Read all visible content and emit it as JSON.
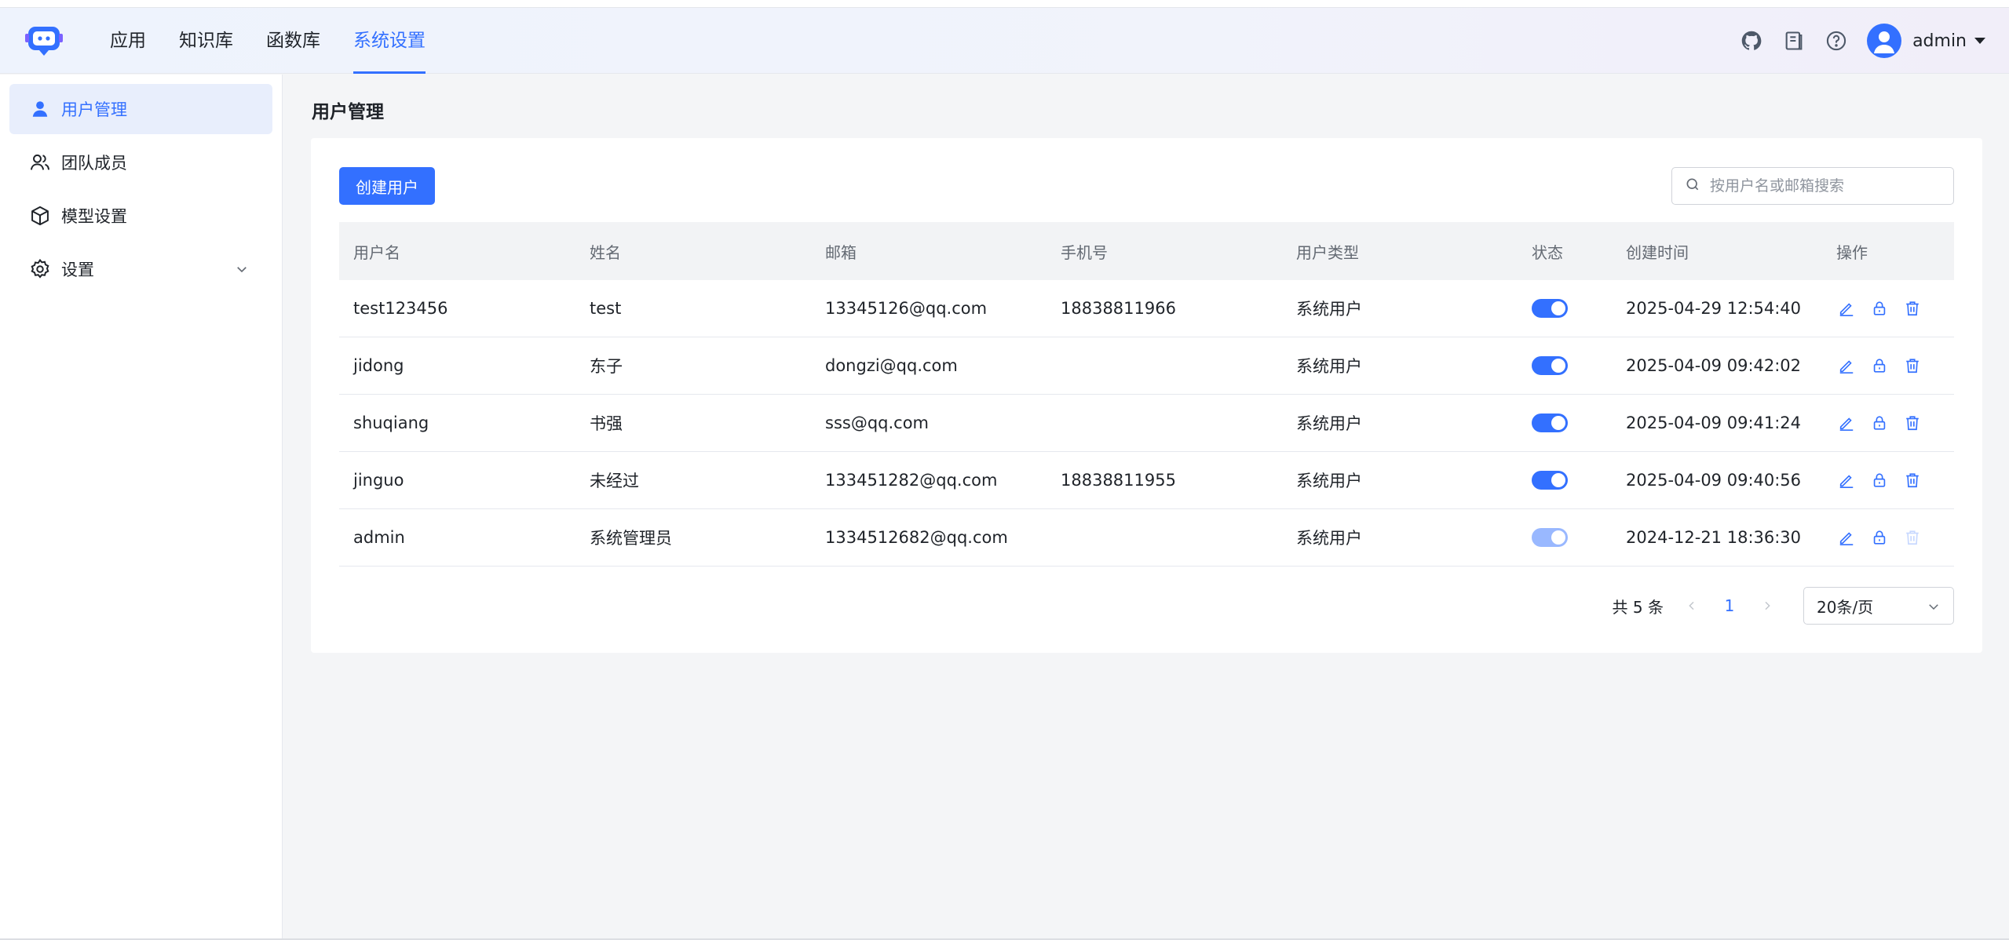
{
  "header": {
    "nav": [
      {
        "label": "应用",
        "active": false
      },
      {
        "label": "知识库",
        "active": false
      },
      {
        "label": "函数库",
        "active": false
      },
      {
        "label": "系统设置",
        "active": true
      }
    ],
    "icons": [
      "github-icon",
      "document-icon",
      "help-icon"
    ],
    "user": {
      "name": "admin"
    }
  },
  "sidebar": {
    "items": [
      {
        "label": "用户管理",
        "icon": "user-icon",
        "active": true
      },
      {
        "label": "团队成员",
        "icon": "team-icon",
        "active": false
      },
      {
        "label": "模型设置",
        "icon": "cube-icon",
        "active": false
      },
      {
        "label": "设置",
        "icon": "gear-icon",
        "active": false,
        "expandable": true
      }
    ]
  },
  "main": {
    "title": "用户管理",
    "create_button": "创建用户",
    "search": {
      "placeholder": "按用户名或邮箱搜索",
      "value": ""
    },
    "table": {
      "columns": [
        "用户名",
        "姓名",
        "邮箱",
        "手机号",
        "用户类型",
        "状态",
        "创建时间",
        "操作"
      ],
      "rows": [
        {
          "username": "test123456",
          "name": "test",
          "email": "13345126@qq.com",
          "phone": "18838811966",
          "type": "系统用户",
          "enabled": true,
          "toggle_disabled": false,
          "created": "2025-04-29 12:54:40",
          "delete_disabled": false
        },
        {
          "username": "jidong",
          "name": "东子",
          "email": "dongzi@qq.com",
          "phone": "",
          "type": "系统用户",
          "enabled": true,
          "toggle_disabled": false,
          "created": "2025-04-09 09:42:02",
          "delete_disabled": false
        },
        {
          "username": "shuqiang",
          "name": "书强",
          "email": "sss@qq.com",
          "phone": "",
          "type": "系统用户",
          "enabled": true,
          "toggle_disabled": false,
          "created": "2025-04-09 09:41:24",
          "delete_disabled": false
        },
        {
          "username": "jinguo",
          "name": "未经过",
          "email": "133451282@qq.com",
          "phone": "18838811955",
          "type": "系统用户",
          "enabled": true,
          "toggle_disabled": false,
          "created": "2025-04-09 09:40:56",
          "delete_disabled": false
        },
        {
          "username": "admin",
          "name": "系统管理员",
          "email": "1334512682@qq.com",
          "phone": "",
          "type": "系统用户",
          "enabled": true,
          "toggle_disabled": true,
          "created": "2024-12-21 18:36:30",
          "delete_disabled": true
        }
      ]
    },
    "pagination": {
      "total": "共 5 条",
      "current_page": "1",
      "page_size": "20条/页"
    }
  },
  "colors": {
    "accent": "#3370ff",
    "accent_disabled": "#99b8ff",
    "text": "#1f2329",
    "muted": "#646a73"
  }
}
